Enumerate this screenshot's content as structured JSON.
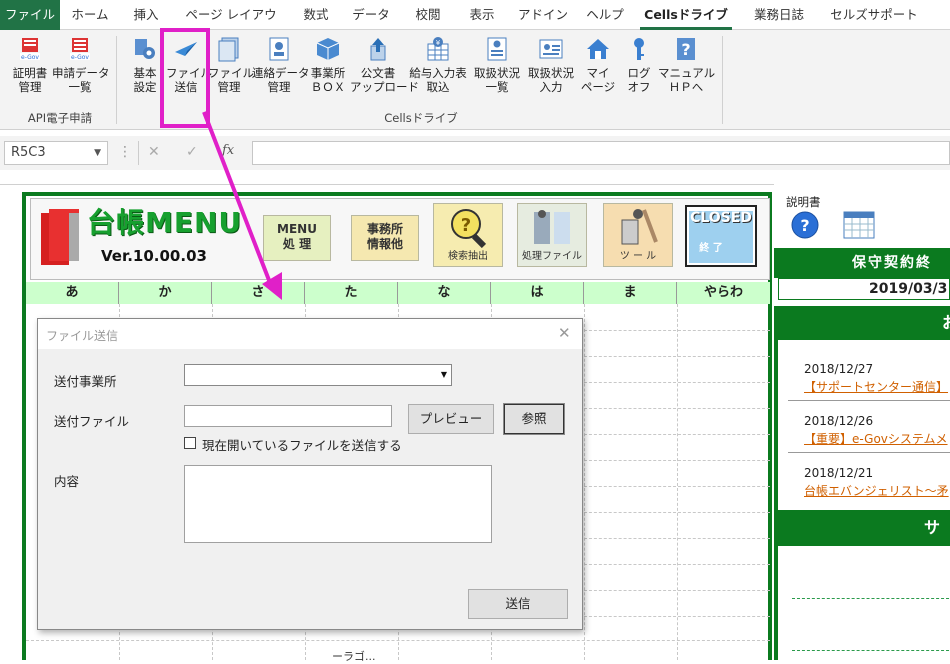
{
  "ribbon_tabs": [
    "ファイル",
    "ホーム",
    "挿入",
    "ページ レイアウト",
    "数式",
    "データ",
    "校閲",
    "表示",
    "アドイン",
    "ヘルプ",
    "Cellsドライブ",
    "業務日誌",
    "セルズサポート"
  ],
  "ribbon": {
    "group1_buttons": [
      "証明書\n管理",
      "申請データ\n一覧"
    ],
    "group1_label": "API電子申請",
    "group2_buttons": [
      "基本\n設定",
      "ファイル\n送信",
      "ファイル\n管理",
      "連絡データ\n管理",
      "事業所\nＢＯＸ",
      "公文書\nアップロード",
      "給与入力表\n取込",
      "取扱状況\n一覧",
      "取扱状況\n入力",
      "マイ\nページ",
      "ログ\nオフ",
      "マニュアル\nＨＰへ"
    ],
    "group2_label": "Cellsドライブ",
    "egov": "e-Gov"
  },
  "formula_bar": {
    "namebox": "R5C3",
    "fx": "fx",
    "cancel": "✕",
    "enter": "✓"
  },
  "menu": {
    "title": "台帳MENU",
    "version": "Ver.10.00.03",
    "btn_menu": "MENU\n処 理",
    "btn_office": "事務所\n情報他",
    "btn_search": "検索抽出",
    "btn_process": "処理ファイル",
    "btn_tool": "ツ ー ル",
    "btn_closed": "CLOSED",
    "btn_closed_sub": "終 了",
    "kana": [
      "あ",
      "か",
      "さ",
      "た",
      "な",
      "は",
      "ま",
      "やらわ"
    ],
    "bottom_text": "ーラゴ..."
  },
  "right": {
    "manual_label": "説明書",
    "contract_title": "保守契約終",
    "contract_date": "2019/03/3",
    "news_header": "お",
    "news": [
      {
        "date": "2018/12/27",
        "title": "【サポートセンター通信】"
      },
      {
        "date": "2018/12/26",
        "title": "【重要】e-Govシステムメ"
      },
      {
        "date": "2018/12/21",
        "title": "台帳エバンジェリスト～矛"
      }
    ],
    "section2_header": "サ"
  },
  "dialog": {
    "title": "ファイル送信",
    "close": "✕",
    "label_office": "送付事業所",
    "label_file": "送付ファイル",
    "checkbox_label": "現在開いているファイルを送信する",
    "label_content": "内容",
    "btn_preview": "プレビュー",
    "btn_browse": "参照",
    "btn_send": "送信"
  },
  "colors": {
    "excel_green": "#217346",
    "menu_green": "#0b7a1f",
    "highlight": "#e020c8",
    "kana_bg": "#ccffcc",
    "right_green": "#0b7a1f"
  }
}
